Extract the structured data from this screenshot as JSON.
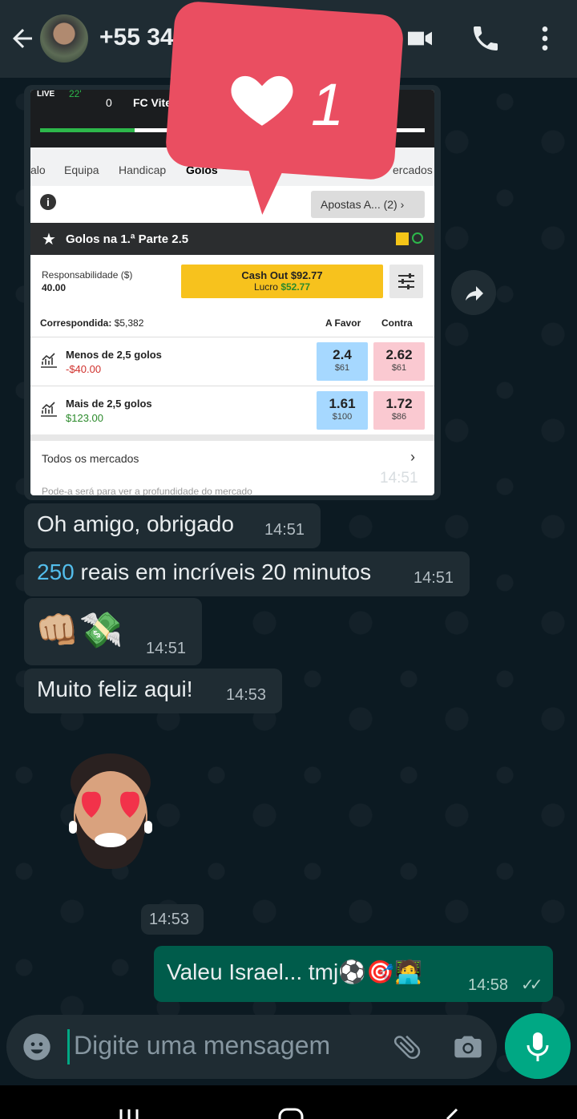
{
  "header": {
    "contact": "+55 34",
    "icons": [
      "back-arrow-icon",
      "video-call-icon",
      "phone-icon",
      "more-icon"
    ]
  },
  "like_badge": {
    "count": "1",
    "icon": "heart-icon",
    "color": "#ea4e61"
  },
  "screenshot": {
    "live": "LIVE",
    "live_minute": "22'",
    "score": "0",
    "team": "FC Vite",
    "tabs": [
      "alo",
      "Equipa",
      "Handicap",
      "Golos",
      "ercados"
    ],
    "apostas": "Apostas A... (2)",
    "market_title": "Golos na 1.ª Parte 2.5",
    "responsibility_label": "Responsabilidade ($)",
    "responsibility_value": "40.00",
    "cashout": "Cash Out $92.77",
    "profit_label": "Lucro",
    "profit_value": "$52.77",
    "matched_label": "Correspondida:",
    "matched_value": "$5,382",
    "col_back": "A Favor",
    "col_lay": "Contra",
    "selections": [
      {
        "name": "Menos de 2,5 golos",
        "pl": "-$40.00",
        "pl_color": "#d0312d",
        "back": "2.4",
        "back_size": "$61",
        "lay": "2.62",
        "lay_size": "$61"
      },
      {
        "name": "Mais de 2,5 golos",
        "pl": "$123.00",
        "pl_color": "#2b8a2b",
        "back": "1.61",
        "back_size": "$100",
        "lay": "1.72",
        "lay_size": "$86"
      }
    ],
    "all_markets": "Todos os mercados",
    "cut_text": "Pode-a será para ver a profundidade do mercado",
    "time": "14:51"
  },
  "messages": [
    {
      "text": "Oh amigo, obrigado",
      "time": "14:51"
    },
    {
      "highlight": "250",
      "text": " reais em incríveis 20 minutos",
      "time": "14:51"
    },
    {
      "text": "👊🏼💸",
      "time": "14:51"
    },
    {
      "text": "Muito feliz aqui!",
      "time": "14:53"
    },
    {
      "text": "",
      "time": "14:53"
    }
  ],
  "outgoing": {
    "text": "Valeu Israel... tmj⚽🎯🧑‍💻",
    "time": "14:58",
    "ticks": "✓✓"
  },
  "composer": {
    "placeholder": "Digite uma mensagem"
  },
  "colors": {
    "header": "#1f2c33",
    "bubble_in": "#1f2c33",
    "bubble_out": "#005c4b",
    "accent": "#00a884"
  }
}
